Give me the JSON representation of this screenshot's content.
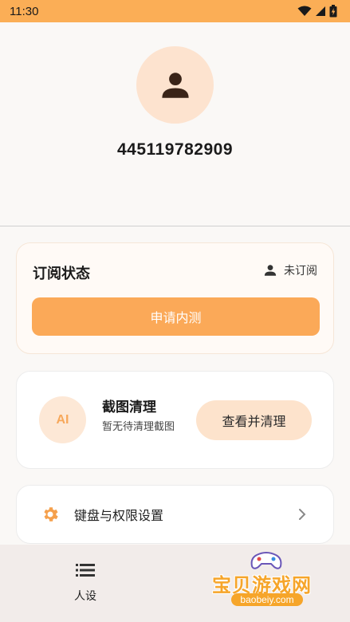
{
  "status_bar": {
    "time": "11:30",
    "icons": [
      "wifi-icon",
      "signal-icon",
      "battery-icon"
    ]
  },
  "profile": {
    "avatar_icon": "person-icon",
    "user_id": "445119782909"
  },
  "subscription": {
    "title": "订阅状态",
    "state_icon": "person-icon",
    "state": "未订阅",
    "apply_button": "申请内测"
  },
  "screenshot_clean": {
    "badge": "AI",
    "title": "截图清理",
    "description": "暂无待清理截图",
    "button": "查看并清理"
  },
  "settings": {
    "icon": "gear-icon",
    "label": "键盘与权限设置",
    "chevron": "chevron-right-icon"
  },
  "bottom_nav": {
    "items": [
      {
        "icon": "list-icon",
        "label": "人设"
      }
    ]
  },
  "watermark": {
    "text": "宝贝游戏网",
    "domain": "baobeiy.com"
  },
  "colors": {
    "accent": "#fba958",
    "status_bar": "#fbae56",
    "avatar_bg": "#fde3cf",
    "soft_button": "#fde3cc"
  }
}
